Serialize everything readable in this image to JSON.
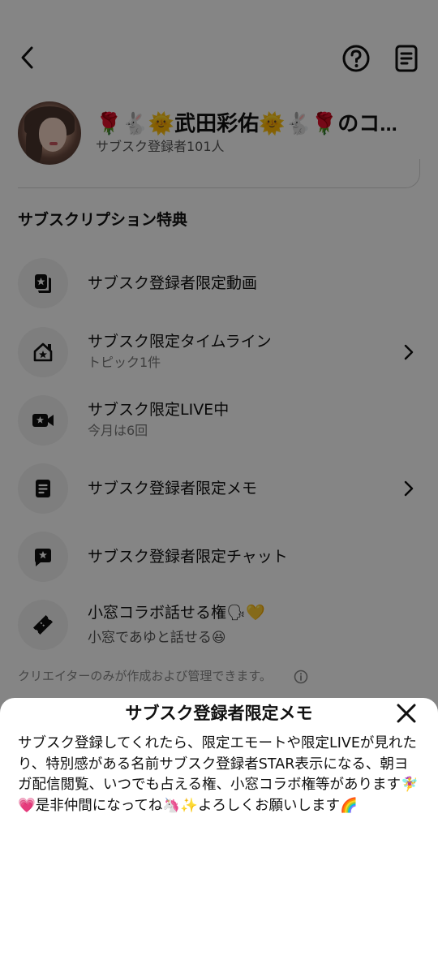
{
  "profile": {
    "name": "🌹🐇🌞武田彩佑🌞🐇🌹のコ...",
    "subscriber_count": "サブスク登録者101人"
  },
  "section_title": "サブスクリプション特典",
  "benefits": [
    {
      "title": "サブスク登録者限定動画",
      "subtitle": "",
      "icon": "video-star-icon",
      "has_chevron": false
    },
    {
      "title": "サブスク限定タイムライン",
      "subtitle": "トピック1件",
      "icon": "home-star-icon",
      "has_chevron": true
    },
    {
      "title": "サブスク限定LIVE中",
      "subtitle": "今月は6回",
      "icon": "camera-star-icon",
      "has_chevron": false
    },
    {
      "title": "サブスク登録者限定メモ",
      "subtitle": "",
      "icon": "memo-icon",
      "has_chevron": true
    },
    {
      "title": "サブスク登録者限定チャット",
      "subtitle": "",
      "icon": "chat-star-icon",
      "has_chevron": false
    },
    {
      "title": "小窓コラボ話せる権🗣💛",
      "subtitle": "小窓であゆと話せる😆",
      "icon": "ticket-icon",
      "has_chevron": false
    }
  ],
  "footer_note": "クリエイターのみが作成および管理できます。",
  "sheet": {
    "title": "サブスク登録者限定メモ",
    "body": "サブスク登録してくれたら、限定エモートや限定LIVEが見れたり、特別感がある名前サブスク登録者STAR表示になる、朝ヨガ配信閲覧、いつでも占える権、小窓コラボ権等があります🧚‍♀️💗是非仲間になってね🦄✨よろしくお願いします🌈"
  },
  "colors": {
    "overlay": "#000000",
    "icon_bg": "#f2f2f2",
    "text_primary": "#111111",
    "text_secondary": "#777777"
  }
}
